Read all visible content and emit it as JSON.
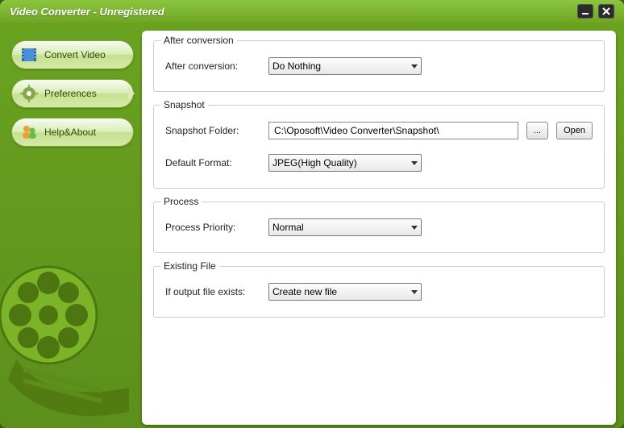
{
  "window": {
    "title": "Video Converter - Unregistered"
  },
  "sidebar": {
    "items": [
      {
        "label": "Convert Video"
      },
      {
        "label": "Preferences"
      },
      {
        "label": "Help&About"
      }
    ]
  },
  "preferences": {
    "after_conversion": {
      "group_title": "After conversion",
      "label": "After conversion:",
      "value": "Do Nothing"
    },
    "snapshot": {
      "group_title": "Snapshot",
      "folder_label": "Snapshot Folder:",
      "folder_value": "C:\\Oposoft\\Video Converter\\Snapshot\\",
      "browse_label": "...",
      "open_label": "Open",
      "format_label": "Default Format:",
      "format_value": "JPEG(High Quality)"
    },
    "process": {
      "group_title": "Process",
      "priority_label": "Process Priority:",
      "priority_value": "Normal"
    },
    "existing_file": {
      "group_title": "Existing File",
      "label": "If output file exists:",
      "value": "Create new file"
    }
  }
}
